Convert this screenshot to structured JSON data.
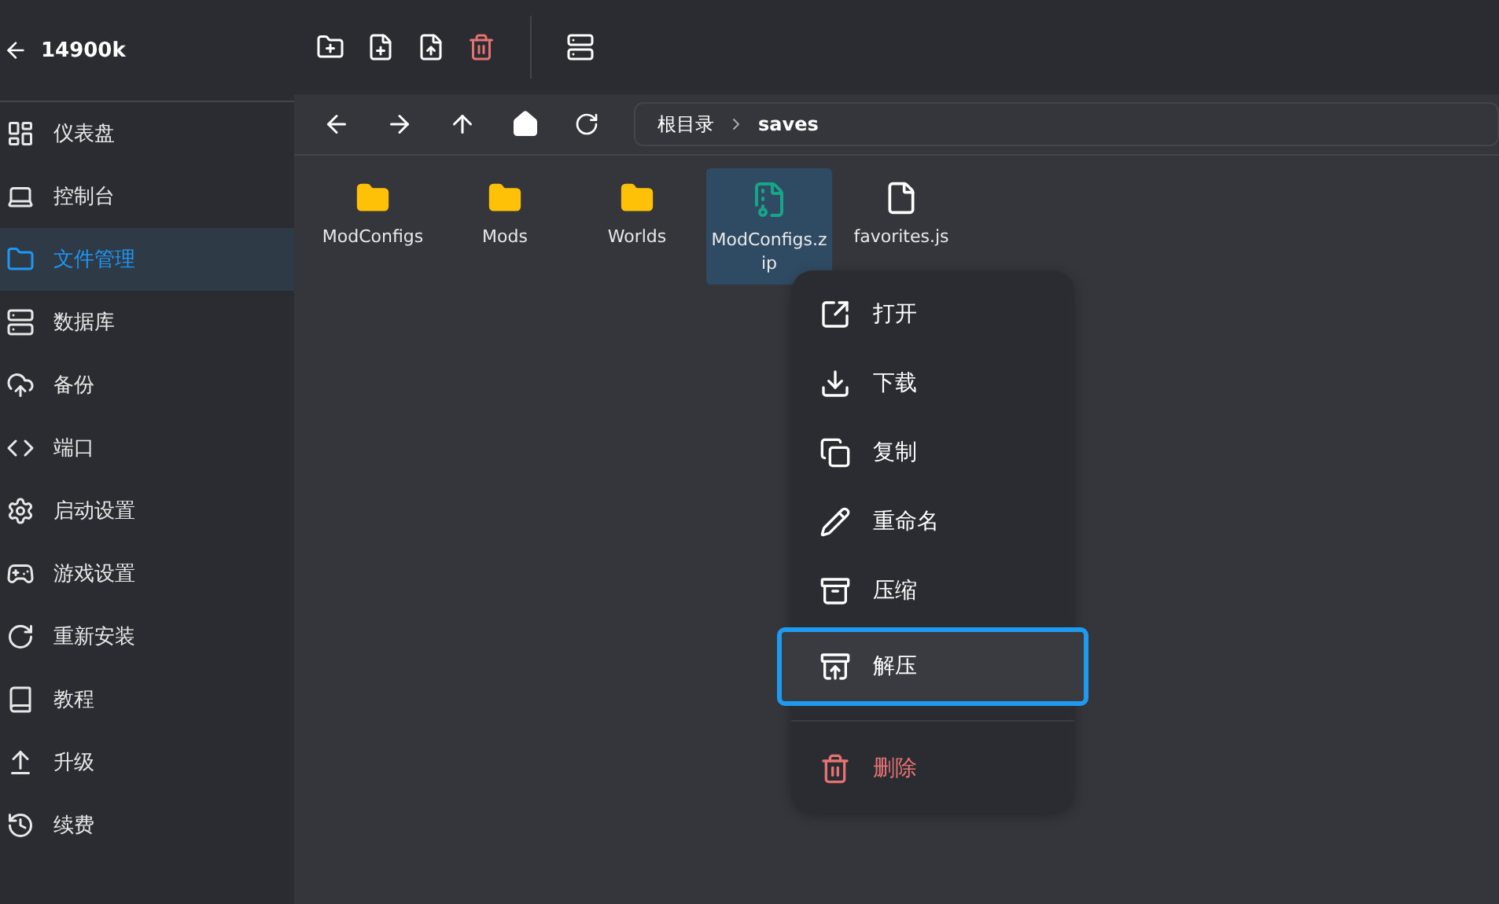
{
  "header": {
    "title": "14900k"
  },
  "sidebar": {
    "items": [
      {
        "label": "仪表盘",
        "selected": false
      },
      {
        "label": "控制台",
        "selected": false
      },
      {
        "label": "文件管理",
        "selected": true
      },
      {
        "label": "数据库",
        "selected": false
      },
      {
        "label": "备份",
        "selected": false
      },
      {
        "label": "端口",
        "selected": false
      },
      {
        "label": "启动设置",
        "selected": false
      },
      {
        "label": "游戏设置",
        "selected": false
      },
      {
        "label": "重新安装",
        "selected": false
      },
      {
        "label": "教程",
        "selected": false
      },
      {
        "label": "升级",
        "selected": false
      },
      {
        "label": "续费",
        "selected": false
      }
    ]
  },
  "breadcrumb": [
    "根目录",
    "saves"
  ],
  "files": [
    {
      "name": "ModConfigs",
      "kind": "folder",
      "selected": false
    },
    {
      "name": "Mods",
      "kind": "folder",
      "selected": false
    },
    {
      "name": "Worlds",
      "kind": "folder",
      "selected": false
    },
    {
      "name": "ModConfigs.zip",
      "kind": "zip",
      "selected": true
    },
    {
      "name": "favorites.js",
      "kind": "file",
      "selected": false
    }
  ],
  "context_menu": [
    {
      "label": "打开",
      "kind": "normal",
      "selected": false
    },
    {
      "label": "下载",
      "kind": "normal",
      "selected": false
    },
    {
      "label": "复制",
      "kind": "normal",
      "selected": false
    },
    {
      "label": "重命名",
      "kind": "normal",
      "selected": false
    },
    {
      "label": "压缩",
      "kind": "normal",
      "selected": false
    },
    {
      "label": "解压",
      "kind": "normal",
      "selected": true
    },
    {
      "label": "删除",
      "kind": "danger",
      "selected": false
    }
  ]
}
